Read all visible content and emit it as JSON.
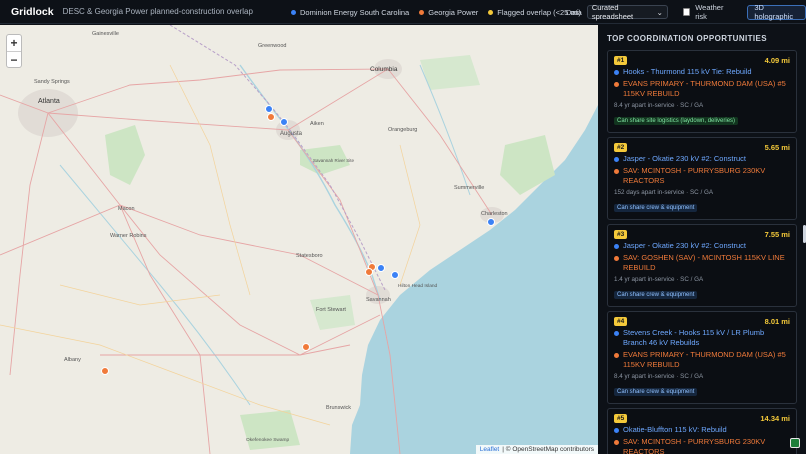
{
  "topbar": {
    "brand": "Gridlock",
    "subtitle": "DESC & Georgia Power planned-construction overlap",
    "legend": [
      {
        "label": "Dominion Energy South Carolina",
        "color": "#3b82f6"
      },
      {
        "label": "Georgia Power",
        "color": "#f07a3a"
      },
      {
        "label": "Flagged overlap (<25 mi)",
        "color": "#f4c93a"
      }
    ],
    "data_label": "Data",
    "data_select": "Curated spreadsheet",
    "weather_label": "Weather risk",
    "holographic_button": "3D holographic"
  },
  "map": {
    "zoom_in": "+",
    "zoom_out": "−",
    "attribution_leaflet": "Leaflet",
    "attribution_osm": "| © OpenStreetMap contributors",
    "labels": [
      {
        "text": "Gainesville"
      },
      {
        "text": "Greenwood"
      },
      {
        "text": "Columbia"
      },
      {
        "text": "Sandy Springs"
      },
      {
        "text": "Atlanta"
      },
      {
        "text": "Aiken"
      },
      {
        "text": "Augusta"
      },
      {
        "text": "Orangeburg"
      },
      {
        "text": "Savannah River Site"
      },
      {
        "text": "Summerville"
      },
      {
        "text": "Charleston"
      },
      {
        "text": "Macon"
      },
      {
        "text": "Warner Robins"
      },
      {
        "text": "Statesboro"
      },
      {
        "text": "Hilton Head Island"
      },
      {
        "text": "Savannah"
      },
      {
        "text": "Fort Stewart"
      },
      {
        "text": "Albany"
      },
      {
        "text": "Brunswick"
      },
      {
        "text": "Okefenokee Swamp"
      }
    ]
  },
  "panel": {
    "title": "TOP COORDINATION OPPORTUNITIES",
    "cards": [
      {
        "rank": "#1",
        "distance": "4.09 mi",
        "desc": "Hooks - Thurmond 115 kV Tie: Rebuild",
        "gp": "EVANS PRIMARY - THURMOND DAM (USA) #5 115KV REBUILD",
        "meta": "8.4 yr apart in-service · SC / GA",
        "tag": "Can share site logistics (laydown, deliveries)",
        "tag_kind": "green"
      },
      {
        "rank": "#2",
        "distance": "5.65 mi",
        "desc": "Jasper - Okatie 230 kV #2: Construct",
        "gp": "SAV: MCINTOSH - PURRYSBURG 230KV REACTORS",
        "meta": "152 days apart in-service · SC / GA",
        "tag": "Can share crew & equipment",
        "tag_kind": "blue"
      },
      {
        "rank": "#3",
        "distance": "7.55 mi",
        "desc": "Jasper - Okatie 230 kV #2: Construct",
        "gp": "SAV: GOSHEN (SAV) - MCINTOSH 115KV LINE REBUILD",
        "meta": "1.4 yr apart in-service · SC / GA",
        "tag": "Can share crew & equipment",
        "tag_kind": "blue"
      },
      {
        "rank": "#4",
        "distance": "8.01 mi",
        "desc": "Stevens Creek - Hooks 115 kV / LR Plumb Branch 46 kV Rebuilds",
        "gp": "EVANS PRIMARY - THURMOND DAM (USA) #5 115KV REBUILD",
        "meta": "8.4 yr apart in-service · SC / GA",
        "tag": "Can share crew & equipment",
        "tag_kind": "blue"
      },
      {
        "rank": "#5",
        "distance": "14.34 mi",
        "desc": "Okatie-Bluffton 115 kV: Rebuild",
        "gp": "SAV: MCINTOSH - PURRYSBURG 230KV REACTORS",
        "meta": "",
        "tag": "",
        "tag_kind": "blue"
      }
    ]
  }
}
